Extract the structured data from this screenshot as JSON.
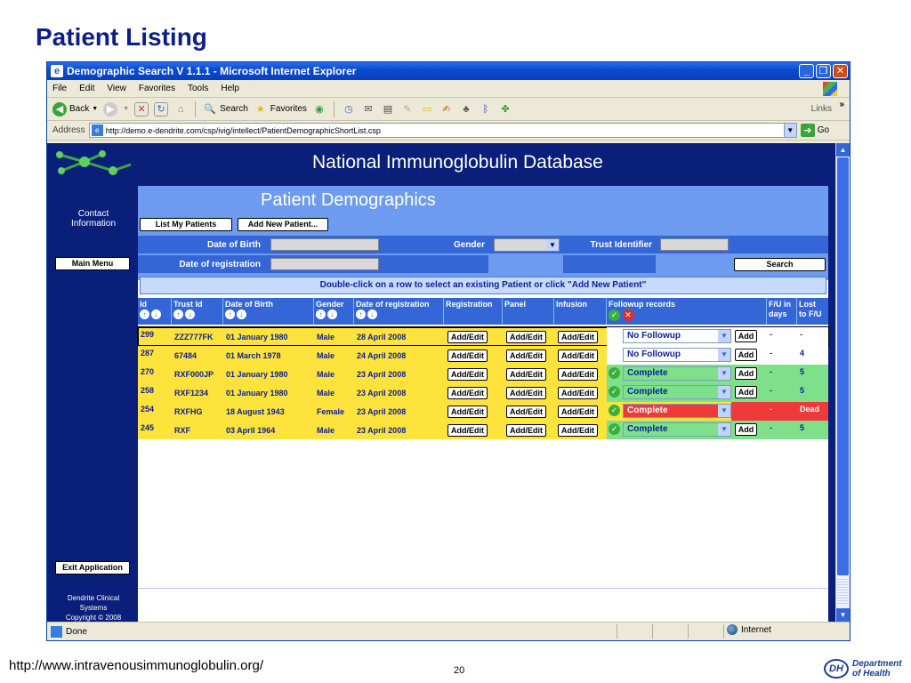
{
  "slide": {
    "title": "Patient Listing",
    "footer_url": "http://www.intravenousimmunoglobulin.org/",
    "page_number": "20",
    "dh_logo_mark": "DH",
    "dh_logo_line1": "Department",
    "dh_logo_line2": "of Health"
  },
  "browser": {
    "window_title": "Demographic Search V 1.1.1 - Microsoft Internet Explorer",
    "menu": [
      "File",
      "Edit",
      "View",
      "Favorites",
      "Tools",
      "Help"
    ],
    "toolbar": {
      "back": "Back",
      "search": "Search",
      "favorites": "Favorites",
      "links": "Links"
    },
    "address_label": "Address",
    "address_url": "http://demo.e-dendrite.com/csp/ivig/intellect/PatientDemographicShortList.csp",
    "go_label": "Go",
    "status_text": "Done",
    "zone_text": "Internet"
  },
  "app": {
    "title": "National Immunoglobulin Database",
    "sidebar": {
      "contact_line1": "Contact",
      "contact_line2": "Information",
      "main_menu": "Main Menu",
      "exit": "Exit Application",
      "footer1": "Dendrite Clinical",
      "footer2": "Systems",
      "footer3": "Copyright © 2008"
    },
    "section_title": "Patient Demographics",
    "buttons": {
      "list_my_patients": "List My Patients",
      "add_new_patient": "Add New Patient...",
      "search": "Search"
    },
    "filters": {
      "date_of_birth": "Date of Birth",
      "gender": "Gender",
      "trust_identifier": "Trust Identifier",
      "date_of_registration": "Date of registration"
    },
    "instruction": "Double-click on a row to select an existing Patient or click \"Add New Patient\"",
    "columns": {
      "id": "Id",
      "trust_id": "Trust Id",
      "dob": "Date of Birth",
      "gender": "Gender",
      "date_registration": "Date of registration",
      "registration": "Registration",
      "panel": "Panel",
      "infusion": "Infusion",
      "followup": "Followup records",
      "fu_days_1": "F/U in",
      "fu_days_2": "days",
      "lost_1": "Lost",
      "lost_2": "to F/U"
    },
    "add_edit": "Add/Edit",
    "add": "Add",
    "rows": [
      {
        "id": "299",
        "trust_id": "ZZZ777FK",
        "dob": "01 January 1980",
        "gender": "Male",
        "reg": "28 April 2008",
        "followup": "No Followup",
        "status": "none",
        "fu_days": "-",
        "lost": "-",
        "selected": true
      },
      {
        "id": "287",
        "trust_id": "67484",
        "dob": "01 March 1978",
        "gender": "Male",
        "reg": "24 April 2008",
        "followup": "No Followup",
        "status": "none",
        "fu_days": "-",
        "lost": "4",
        "selected": false
      },
      {
        "id": "270",
        "trust_id": "RXF000JP",
        "dob": "01 January 1980",
        "gender": "Male",
        "reg": "23 April 2008",
        "followup": "Complete",
        "status": "complete",
        "fu_days": "-",
        "lost": "5",
        "selected": false
      },
      {
        "id": "258",
        "trust_id": "RXF1234",
        "dob": "01 January 1980",
        "gender": "Male",
        "reg": "23 April 2008",
        "followup": "Complete",
        "status": "complete",
        "fu_days": "-",
        "lost": "5",
        "selected": false
      },
      {
        "id": "254",
        "trust_id": "RXFHG",
        "dob": "18 August 1943",
        "gender": "Female",
        "reg": "23 April 2008",
        "followup": "Complete",
        "status": "dead",
        "fu_days": "-",
        "lost": "Dead",
        "selected": false
      },
      {
        "id": "245",
        "trust_id": "RXF",
        "dob": "03 April 1964",
        "gender": "Male",
        "reg": "23 April 2008",
        "followup": "Complete",
        "status": "complete",
        "fu_days": "-",
        "lost": "5",
        "selected": false
      }
    ]
  },
  "colors": {
    "navy": "#0a1f7a",
    "header_blue": "#3466d8",
    "row_yellow": "#fde33b",
    "complete_green": "#7fe08a",
    "dead_red": "#ee3a3a"
  }
}
